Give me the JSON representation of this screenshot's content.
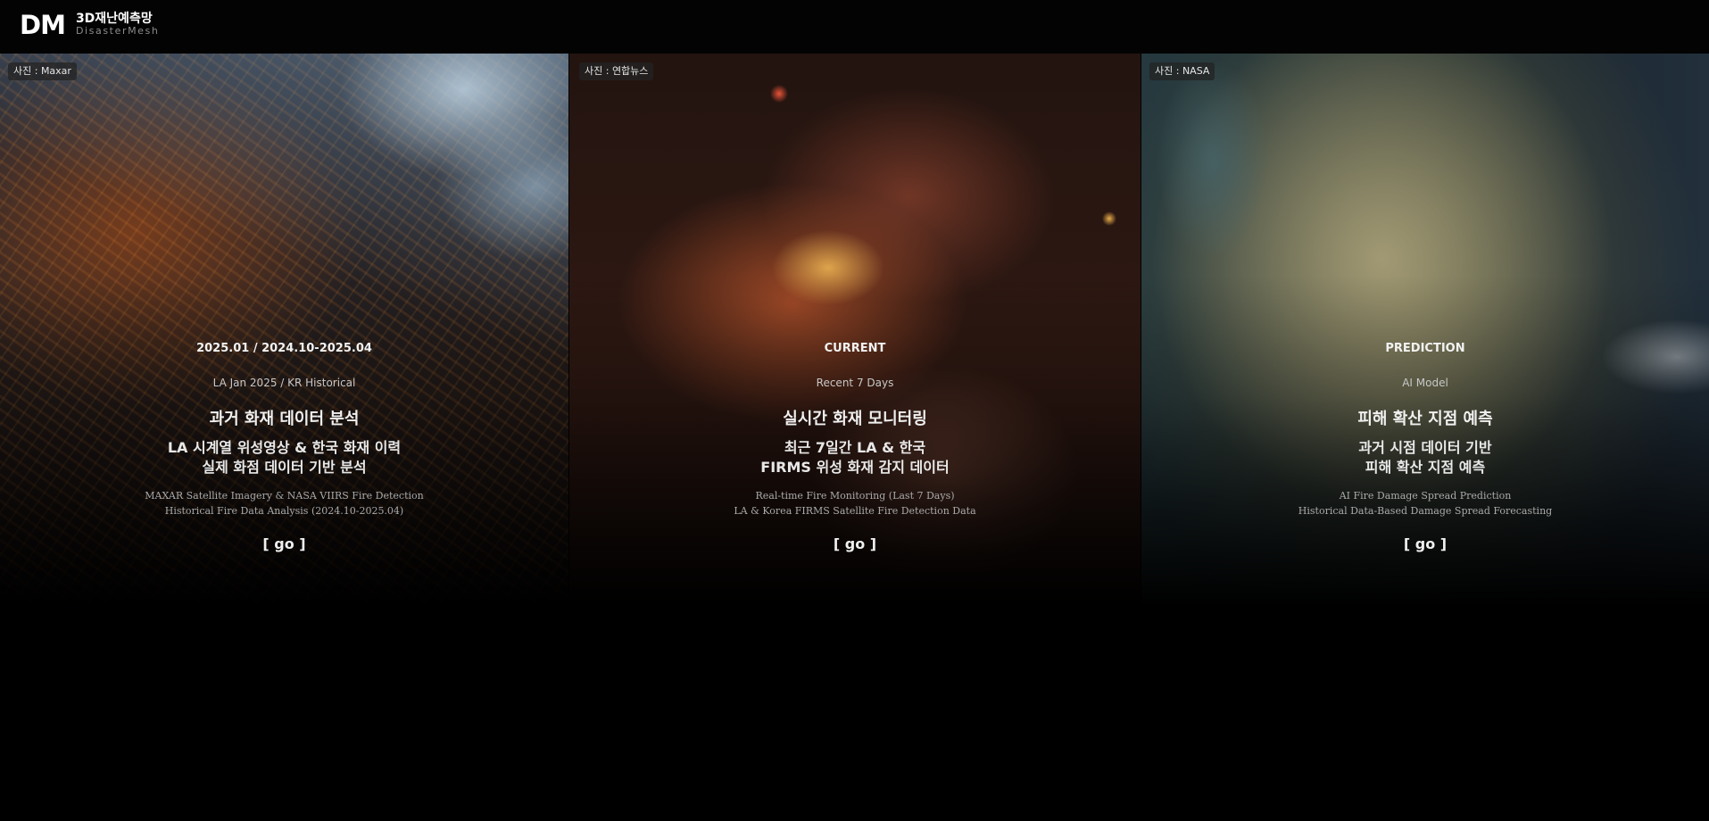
{
  "header": {
    "logo_mark": "DM",
    "title": "3D재난예측망",
    "subtitle": "DisasterMesh"
  },
  "panels": [
    {
      "credit": "사진 : Maxar",
      "label": "2025.01 / 2024.10-2025.04",
      "sublabel": "LA Jan 2025 / KR Historical",
      "title": "과거 화재 데이터 분석",
      "desc_line1": "LA 시계열 위성영상 & 한국 화재 이력",
      "desc_line2": "실제 화점 데이터 기반 분석",
      "en_line1": "MAXAR Satellite Imagery & NASA VIIRS Fire Detection",
      "en_line2": "Historical Fire Data Analysis (2024.10-2025.04)",
      "go": "[ go ]"
    },
    {
      "credit": "사진 : 연합뉴스",
      "label": "CURRENT",
      "sublabel": "Recent 7 Days",
      "title": "실시간 화재 모니터링",
      "desc_line1": "최근 7일간 LA & 한국",
      "desc_line2": "FIRMS 위성 화재 감지 데이터",
      "en_line1": "Real-time Fire Monitoring (Last 7 Days)",
      "en_line2": "LA & Korea FIRMS Satellite Fire Detection Data",
      "go": "[ go ]"
    },
    {
      "credit": "사진 : NASA",
      "label": "PREDICTION",
      "sublabel": "AI Model",
      "title": "피해 확산 지점 예측",
      "desc_line1": "과거 시점 데이터 기반",
      "desc_line2": "피해 확산 지점 예측",
      "en_line1": "AI Fire Damage Spread Prediction",
      "en_line2": "Historical Data-Based Damage Spread Forecasting",
      "go": "[ go ]"
    }
  ]
}
